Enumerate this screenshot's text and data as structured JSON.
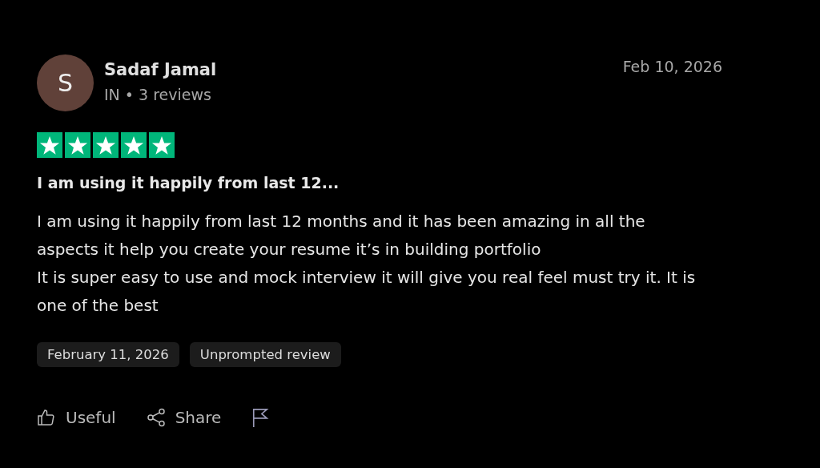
{
  "reviewer": {
    "initial": "S",
    "name": "Sadaf Jamal",
    "meta": "IN • 3 reviews"
  },
  "date": "Feb 10, 2026",
  "stars": 5,
  "title": "I am using it happily from last 12...",
  "body_lines": [
    "I am using it happily from last 12 months and it has been amazing in all the aspects it help you create your resume it’s in building portfolio",
    "It is super easy to use and mock interview it will give you real feel must try it. It is one of the best"
  ],
  "tags": [
    "February 11, 2026",
    "Unprompted review"
  ],
  "actions": [
    {
      "kind": "useful",
      "label": "Useful"
    },
    {
      "kind": "share",
      "label": "Share"
    },
    {
      "kind": "flag"
    }
  ]
}
